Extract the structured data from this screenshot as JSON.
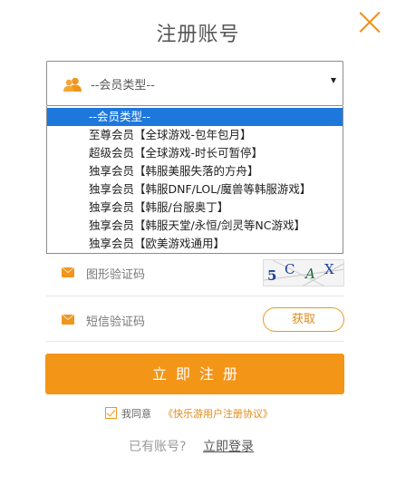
{
  "header": {
    "title": "注册账号"
  },
  "member_select": {
    "value": "--会员类型--",
    "options": [
      "--会员类型--",
      "至尊会员【全球游戏-包年包月】",
      "超级会员【全球游戏-时长可暂停】",
      "独享会员【韩服美服失落的方舟】",
      "独享会员【韩服DNF/LOL/魔兽等韩服游戏】",
      "独享会员【韩服/台服奥丁】",
      "独享会员【韩服天堂/永恒/剑灵等NC游戏】",
      "独享会员【欧美游戏通用】"
    ],
    "selected_index": 0
  },
  "captcha": {
    "placeholder": "图形验证码",
    "image_text": "5CAX"
  },
  "sms": {
    "placeholder": "短信验证码",
    "get_code_label": "获取"
  },
  "submit": {
    "label": "立即注册"
  },
  "agreement": {
    "prefix": "我同意",
    "link": "《快乐游用户注册协议》",
    "checked": true
  },
  "login": {
    "question": "已有账号?",
    "link": "立即登录"
  },
  "colors": {
    "accent": "#f39517",
    "selected_option": "#1e78dc"
  }
}
